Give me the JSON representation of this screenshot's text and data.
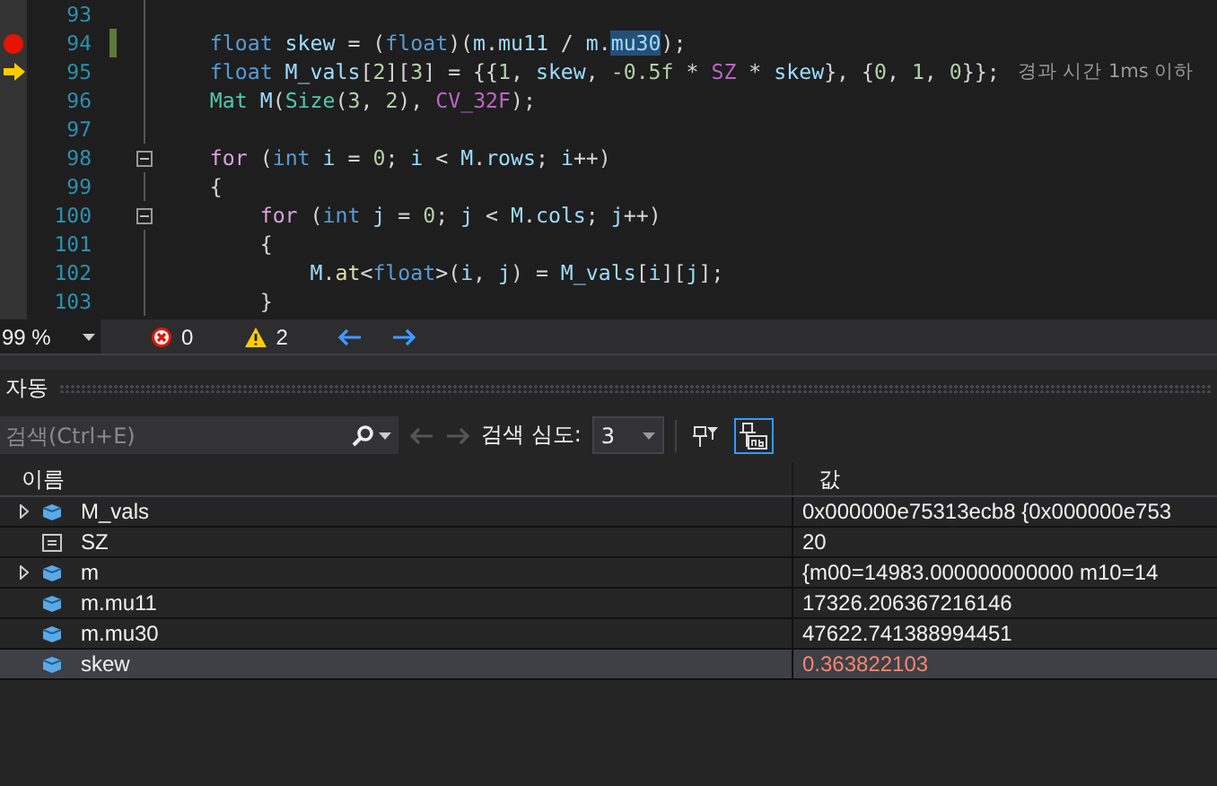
{
  "editor": {
    "lines": [
      {
        "number": "93",
        "breakpoint": false,
        "current": false,
        "changed": false,
        "fold": false
      },
      {
        "number": "94",
        "breakpoint": true,
        "current": false,
        "changed": true,
        "fold": false,
        "tokens": [
          {
            "text": "    float",
            "kind": "keyword"
          },
          {
            "text": " skew",
            "kind": "variable"
          },
          {
            "text": " = (",
            "kind": "plain"
          },
          {
            "text": "float",
            "kind": "keyword"
          },
          {
            "text": ")(",
            "kind": "plain"
          },
          {
            "text": "m",
            "kind": "variable"
          },
          {
            "text": ".",
            "kind": "plain"
          },
          {
            "text": "mu11",
            "kind": "variable"
          },
          {
            "text": " / ",
            "kind": "plain"
          },
          {
            "text": "m",
            "kind": "variable"
          },
          {
            "text": ".",
            "kind": "plain"
          },
          {
            "text": "mu30",
            "kind": "selection"
          },
          {
            "text": ");",
            "kind": "plain"
          }
        ]
      },
      {
        "number": "95",
        "breakpoint": false,
        "current": true,
        "changed": false,
        "fold": false,
        "tokens": [
          {
            "text": "    float",
            "kind": "keyword"
          },
          {
            "text": " M_vals",
            "kind": "variable"
          },
          {
            "text": "[",
            "kind": "plain"
          },
          {
            "text": "2",
            "kind": "number"
          },
          {
            "text": "][",
            "kind": "plain"
          },
          {
            "text": "3",
            "kind": "number"
          },
          {
            "text": "] = {{",
            "kind": "plain"
          },
          {
            "text": "1",
            "kind": "number"
          },
          {
            "text": ", ",
            "kind": "plain"
          },
          {
            "text": "skew",
            "kind": "variable"
          },
          {
            "text": ", ",
            "kind": "plain"
          },
          {
            "text": "-0.5f",
            "kind": "number"
          },
          {
            "text": " * ",
            "kind": "plain"
          },
          {
            "text": "SZ",
            "kind": "macro"
          },
          {
            "text": " * ",
            "kind": "plain"
          },
          {
            "text": "skew",
            "kind": "variable"
          },
          {
            "text": "}, {",
            "kind": "plain"
          },
          {
            "text": "0",
            "kind": "number"
          },
          {
            "text": ", ",
            "kind": "plain"
          },
          {
            "text": "1",
            "kind": "number"
          },
          {
            "text": ", ",
            "kind": "plain"
          },
          {
            "text": "0",
            "kind": "number"
          },
          {
            "text": "}};",
            "kind": "plain"
          }
        ],
        "hint": "경과 시간 1ms 이하"
      },
      {
        "number": "96",
        "breakpoint": false,
        "current": false,
        "changed": false,
        "fold": false,
        "tokens": [
          {
            "text": "    Mat",
            "kind": "type"
          },
          {
            "text": " M",
            "kind": "variable"
          },
          {
            "text": "(",
            "kind": "plain"
          },
          {
            "text": "Size",
            "kind": "type"
          },
          {
            "text": "(",
            "kind": "plain"
          },
          {
            "text": "3",
            "kind": "number"
          },
          {
            "text": ", ",
            "kind": "plain"
          },
          {
            "text": "2",
            "kind": "number"
          },
          {
            "text": "), ",
            "kind": "plain"
          },
          {
            "text": "CV_32F",
            "kind": "macro"
          },
          {
            "text": ");",
            "kind": "plain"
          }
        ]
      },
      {
        "number": "97",
        "breakpoint": false,
        "current": false,
        "changed": false,
        "fold": false
      },
      {
        "number": "98",
        "breakpoint": false,
        "current": false,
        "changed": false,
        "fold": true,
        "tokens": [
          {
            "text": "    for",
            "kind": "control"
          },
          {
            "text": " (",
            "kind": "plain"
          },
          {
            "text": "int",
            "kind": "keyword"
          },
          {
            "text": " i",
            "kind": "variable"
          },
          {
            "text": " = ",
            "kind": "plain"
          },
          {
            "text": "0",
            "kind": "number"
          },
          {
            "text": "; ",
            "kind": "plain"
          },
          {
            "text": "i",
            "kind": "variable"
          },
          {
            "text": " < ",
            "kind": "plain"
          },
          {
            "text": "M",
            "kind": "variable"
          },
          {
            "text": ".",
            "kind": "plain"
          },
          {
            "text": "rows",
            "kind": "variable"
          },
          {
            "text": "; ",
            "kind": "plain"
          },
          {
            "text": "i",
            "kind": "variable"
          },
          {
            "text": "++)",
            "kind": "plain"
          }
        ]
      },
      {
        "number": "99",
        "breakpoint": false,
        "current": false,
        "changed": false,
        "fold": false,
        "tokens": [
          {
            "text": "    {",
            "kind": "plain"
          }
        ]
      },
      {
        "number": "100",
        "breakpoint": false,
        "current": false,
        "changed": false,
        "fold": true,
        "tokens": [
          {
            "text": "        for",
            "kind": "control"
          },
          {
            "text": " (",
            "kind": "plain"
          },
          {
            "text": "int",
            "kind": "keyword"
          },
          {
            "text": " j",
            "kind": "variable"
          },
          {
            "text": " = ",
            "kind": "plain"
          },
          {
            "text": "0",
            "kind": "number"
          },
          {
            "text": "; ",
            "kind": "plain"
          },
          {
            "text": "j",
            "kind": "variable"
          },
          {
            "text": " < ",
            "kind": "plain"
          },
          {
            "text": "M",
            "kind": "variable"
          },
          {
            "text": ".",
            "kind": "plain"
          },
          {
            "text": "cols",
            "kind": "variable"
          },
          {
            "text": "; ",
            "kind": "plain"
          },
          {
            "text": "j",
            "kind": "variable"
          },
          {
            "text": "++)",
            "kind": "plain"
          }
        ]
      },
      {
        "number": "101",
        "breakpoint": false,
        "current": false,
        "changed": false,
        "fold": false,
        "tokens": [
          {
            "text": "        {",
            "kind": "plain"
          }
        ]
      },
      {
        "number": "102",
        "breakpoint": false,
        "current": false,
        "changed": false,
        "fold": false,
        "tokens": [
          {
            "text": "            M",
            "kind": "variable"
          },
          {
            "text": ".",
            "kind": "plain"
          },
          {
            "text": "at",
            "kind": "function"
          },
          {
            "text": "<",
            "kind": "plain"
          },
          {
            "text": "float",
            "kind": "keyword"
          },
          {
            "text": ">(",
            "kind": "plain"
          },
          {
            "text": "i",
            "kind": "variable"
          },
          {
            "text": ", ",
            "kind": "plain"
          },
          {
            "text": "j",
            "kind": "variable"
          },
          {
            "text": ") = ",
            "kind": "plain"
          },
          {
            "text": "M_vals",
            "kind": "variable"
          },
          {
            "text": "[",
            "kind": "plain"
          },
          {
            "text": "i",
            "kind": "variable"
          },
          {
            "text": "][",
            "kind": "plain"
          },
          {
            "text": "j",
            "kind": "variable"
          },
          {
            "text": "];",
            "kind": "plain"
          }
        ]
      },
      {
        "number": "103",
        "breakpoint": false,
        "current": false,
        "changed": false,
        "fold": false,
        "tokens": [
          {
            "text": "        }",
            "kind": "plain"
          }
        ]
      }
    ]
  },
  "status_bar": {
    "zoom": "99 %",
    "errors": "0",
    "warnings": "2"
  },
  "autos_panel": {
    "title": "자동",
    "search": {
      "placeholder": "검색(Ctrl+E)"
    },
    "depth_label": "검색 심도:",
    "depth": "3",
    "raw_view_on": true,
    "columns": [
      "이름",
      "값"
    ],
    "rows": [
      {
        "name": "M_vals",
        "kind": "object",
        "expandable": true,
        "value": "0x000000e75313ecb8 {0x000000e753",
        "changed": false,
        "selected": false
      },
      {
        "name": "SZ",
        "kind": "constant",
        "expandable": false,
        "value": "20",
        "changed": false,
        "selected": false
      },
      {
        "name": "m",
        "kind": "object",
        "expandable": true,
        "value": "{m00=14983.000000000000 m10=14",
        "changed": false,
        "selected": false
      },
      {
        "name": "m.mu11",
        "kind": "object",
        "expandable": false,
        "value": "17326.206367216146",
        "changed": false,
        "selected": false
      },
      {
        "name": "m.mu30",
        "kind": "object",
        "expandable": false,
        "value": "47622.741388994451",
        "changed": false,
        "selected": false
      },
      {
        "name": "skew",
        "kind": "object",
        "expandable": false,
        "value": "0.363822103",
        "changed": true,
        "selected": true
      }
    ]
  }
}
